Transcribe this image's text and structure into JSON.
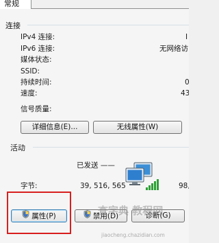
{
  "tab": {
    "label": "常规"
  },
  "connection": {
    "title": "连接",
    "rows": [
      {
        "label": "IPv4 连接:",
        "value": "I"
      },
      {
        "label": "IPv6 连接:",
        "value": "无网络访"
      },
      {
        "label": "媒体状态:",
        "value": ""
      },
      {
        "label": "SSID:",
        "value": ""
      },
      {
        "label": "持续时间:",
        "value": "0"
      },
      {
        "label": "速度:",
        "value": "43"
      }
    ],
    "signal_label": "信号质量:",
    "details_button": "详细信息(E)...",
    "wireless_button": "无线属性(W)"
  },
  "activity": {
    "title": "活动",
    "sent_label": "已发送 ——",
    "bytes_label": "字节:",
    "bytes_sent": "39, 516, 565",
    "bytes_received": "98,"
  },
  "buttons": {
    "properties": "属性(P)",
    "disable": "禁用(D)",
    "diagnose": "诊断(G)"
  },
  "watermark": {
    "text": "查字典 教程网",
    "sub": "jiaocheng.chazidian.com"
  }
}
